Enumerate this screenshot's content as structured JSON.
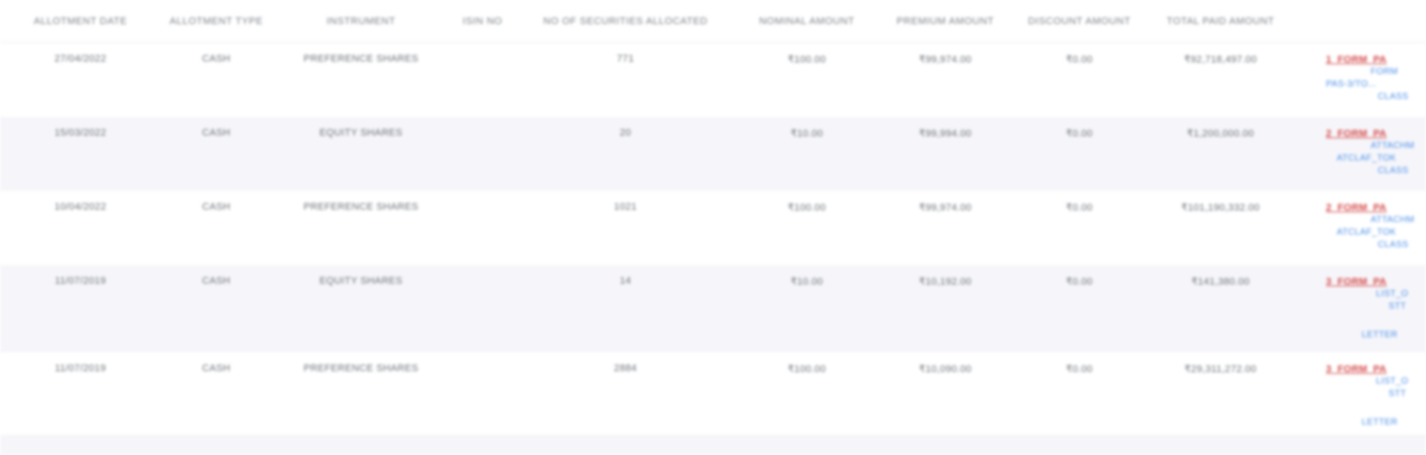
{
  "headers": [
    "ALLOTMENT DATE",
    "ALLOTMENT TYPE",
    "INSTRUMENT",
    "ISIN NO",
    "NO OF SECURITIES ALLOCATED",
    "NOMINAL AMOUNT",
    "PREMIUM AMOUNT",
    "DISCOUNT AMOUNT",
    "TOTAL PAID AMOUNT",
    ""
  ],
  "rows": [
    {
      "date": "27/04/2022",
      "type": "CASH",
      "instrument": "PREFERENCE SHARES",
      "isin": "",
      "securities": "771",
      "nominal": "₹100.00",
      "premium": "₹99,974.00",
      "discount": "₹0.00",
      "total": "₹92,718,497.00",
      "doc_main": "1_FORM_PA",
      "doc_subs": [
        "FORM",
        "PAS-3/TO...",
        "CLASS"
      ],
      "doc_letter": ""
    },
    {
      "date": "15/03/2022",
      "type": "CASH",
      "instrument": "EQUITY SHARES",
      "isin": "",
      "securities": "20",
      "nominal": "₹10.00",
      "premium": "₹99,994.00",
      "discount": "₹0.00",
      "total": "₹1,200,000.00",
      "doc_main": "2_FORM_PA",
      "doc_subs": [
        "ATTACHM",
        "ATCLAF_TOK",
        "CLASS"
      ],
      "doc_letter": ""
    },
    {
      "date": "10/04/2022",
      "type": "CASH",
      "instrument": "PREFERENCE SHARES",
      "isin": "",
      "securities": "1021",
      "nominal": "₹100.00",
      "premium": "₹99,974.00",
      "discount": "₹0.00",
      "total": "₹101,190,332.00",
      "doc_main": "2_FORM_PA",
      "doc_subs": [
        "ATTACHM",
        "ATCLAF_TOK",
        "CLASS"
      ],
      "doc_letter": ""
    },
    {
      "date": "11/07/2019",
      "type": "CASH",
      "instrument": "EQUITY SHARES",
      "isin": "",
      "securities": "14",
      "nominal": "₹10.00",
      "premium": "₹10,192.00",
      "discount": "₹0.00",
      "total": "₹141,380.00",
      "doc_main": "3_FORM_PA",
      "doc_subs": [
        "LIST_O",
        "STT"
      ],
      "doc_letter": "LETTER"
    },
    {
      "date": "11/07/2019",
      "type": "CASH",
      "instrument": "PREFERENCE SHARES",
      "isin": "",
      "securities": "2884",
      "nominal": "₹100.00",
      "premium": "₹10,090.00",
      "discount": "₹0.00",
      "total": "₹29,311,272.00",
      "doc_main": "3_FORM_PA",
      "doc_subs": [
        "LIST_O",
        "STT"
      ],
      "doc_letter": "LETTER"
    }
  ],
  "colors": {
    "header_text": "#7a7f87",
    "row_alt_bg": "#f6f6fa",
    "doc_main": "#d54b4b",
    "doc_link": "#4b8ee8"
  }
}
